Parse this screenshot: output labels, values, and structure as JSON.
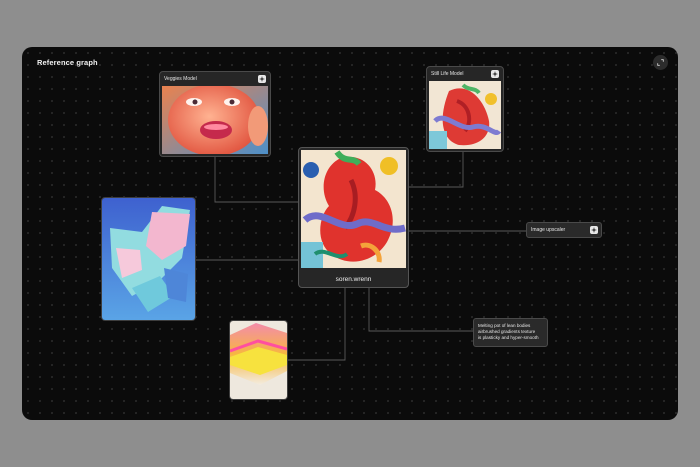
{
  "graph": {
    "title": "Reference graph"
  },
  "nodes": {
    "veggies_model": {
      "label": "Veggies Model"
    },
    "still_life_model": {
      "label": "Still Life Model"
    },
    "center": {
      "username": "soren.wrenn"
    },
    "image_upscaler": {
      "label": "Image upscaler"
    },
    "prompt": {
      "lines": [
        "Melting pot of lean bodies",
        "airbrushed gradients texture",
        "is plasticky and hyper-smooth"
      ]
    }
  },
  "icons": {
    "expand": "expand-icon",
    "sparkle": "sparkle-icon"
  },
  "colors": {
    "canvas": "#0b0b0b",
    "card": "#262626",
    "connector": "#5a5a5a"
  }
}
